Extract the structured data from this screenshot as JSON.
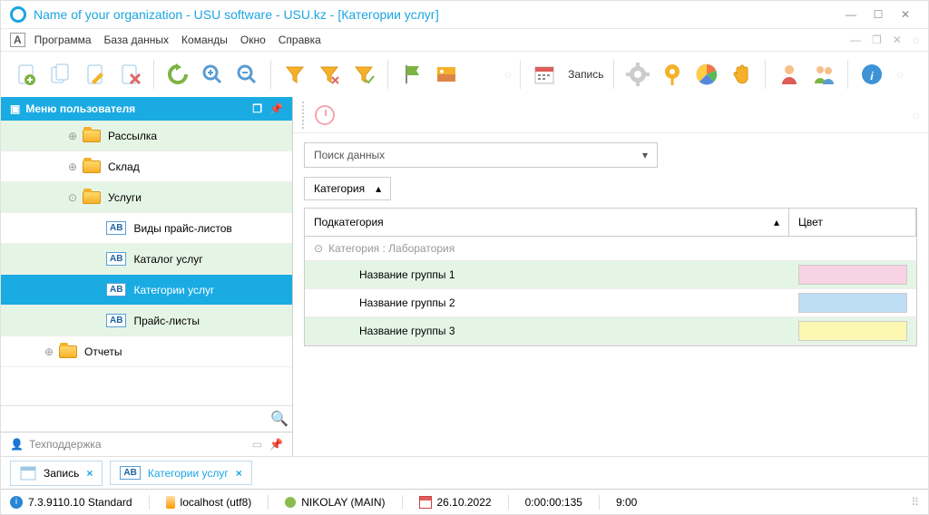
{
  "window": {
    "title": "Name of your organization - USU software - USU.kz - [Категории услуг]"
  },
  "menu": {
    "program": "Программа",
    "database": "База данных",
    "commands": "Команды",
    "window": "Окно",
    "help": "Справка"
  },
  "toolbar": {
    "record": "Запись"
  },
  "sidebar": {
    "header": "Меню пользователя",
    "items": [
      {
        "label": "Рассылка",
        "icon": "folder",
        "depth": 2
      },
      {
        "label": "Склад",
        "icon": "folder",
        "depth": 2
      },
      {
        "label": "Услуги",
        "icon": "folder",
        "depth": 2,
        "expanded": true
      },
      {
        "label": "Виды прайс-листов",
        "icon": "ab",
        "depth": 3
      },
      {
        "label": "Каталог услуг",
        "icon": "ab",
        "depth": 3
      },
      {
        "label": "Категории услуг",
        "icon": "ab",
        "depth": 3,
        "selected": true
      },
      {
        "label": "Прайс-листы",
        "icon": "ab",
        "depth": 3
      },
      {
        "label": "Отчеты",
        "icon": "folder",
        "depth": 1
      }
    ],
    "support": "Техподдержка"
  },
  "content": {
    "search_placeholder": "Поиск данных",
    "chip_label": "Категория",
    "grid": {
      "col_sub": "Подкатегория",
      "col_color": "Цвет",
      "group_label": "Категория : Лаборатория",
      "rows": [
        {
          "name": "Название группы 1",
          "bg": "#e5f5e5",
          "color": "#f8d3e3"
        },
        {
          "name": "Название группы 2",
          "bg": "#ffffff",
          "color": "#bddef5"
        },
        {
          "name": "Название группы 3",
          "bg": "#e5f5e5",
          "color": "#fcf8b4"
        }
      ]
    }
  },
  "tabs": [
    {
      "label": "Запись",
      "icon": "window"
    },
    {
      "label": "Категории услуг",
      "icon": "ab"
    }
  ],
  "status": {
    "version": "7.3.9110.10 Standard",
    "host": "localhost (utf8)",
    "user": "NIKOLAY (MAIN)",
    "date": "26.10.2022",
    "time": "0:00:00:135",
    "extra": "9:00"
  }
}
